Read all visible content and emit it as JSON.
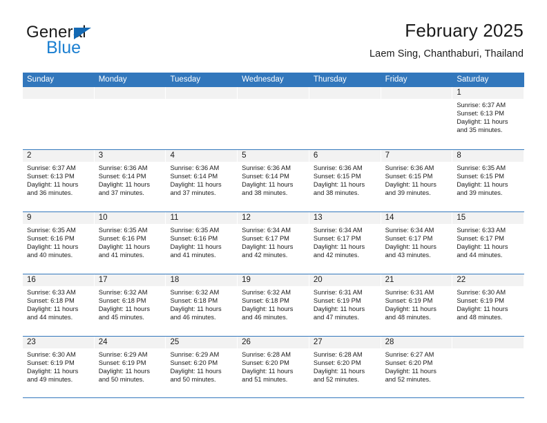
{
  "brand": {
    "name_primary": "General",
    "name_secondary": "Blue",
    "accent_color": "#1268b3",
    "secondary_color": "#1b7fd1"
  },
  "header": {
    "title": "February 2025",
    "subtitle": "Laem Sing, Chanthaburi, Thailand"
  },
  "calendar": {
    "header_bg": "#3277bc",
    "daynum_bg": "#f2f2f2",
    "weekday_headers": [
      "Sunday",
      "Monday",
      "Tuesday",
      "Wednesday",
      "Thursday",
      "Friday",
      "Saturday"
    ],
    "weeks": [
      [
        {
          "day": "",
          "lines": []
        },
        {
          "day": "",
          "lines": []
        },
        {
          "day": "",
          "lines": []
        },
        {
          "day": "",
          "lines": []
        },
        {
          "day": "",
          "lines": []
        },
        {
          "day": "",
          "lines": []
        },
        {
          "day": "1",
          "lines": [
            "Sunrise: 6:37 AM",
            "Sunset: 6:13 PM",
            "Daylight: 11 hours",
            "and 35 minutes."
          ]
        }
      ],
      [
        {
          "day": "2",
          "lines": [
            "Sunrise: 6:37 AM",
            "Sunset: 6:13 PM",
            "Daylight: 11 hours",
            "and 36 minutes."
          ]
        },
        {
          "day": "3",
          "lines": [
            "Sunrise: 6:36 AM",
            "Sunset: 6:14 PM",
            "Daylight: 11 hours",
            "and 37 minutes."
          ]
        },
        {
          "day": "4",
          "lines": [
            "Sunrise: 6:36 AM",
            "Sunset: 6:14 PM",
            "Daylight: 11 hours",
            "and 37 minutes."
          ]
        },
        {
          "day": "5",
          "lines": [
            "Sunrise: 6:36 AM",
            "Sunset: 6:14 PM",
            "Daylight: 11 hours",
            "and 38 minutes."
          ]
        },
        {
          "day": "6",
          "lines": [
            "Sunrise: 6:36 AM",
            "Sunset: 6:15 PM",
            "Daylight: 11 hours",
            "and 38 minutes."
          ]
        },
        {
          "day": "7",
          "lines": [
            "Sunrise: 6:36 AM",
            "Sunset: 6:15 PM",
            "Daylight: 11 hours",
            "and 39 minutes."
          ]
        },
        {
          "day": "8",
          "lines": [
            "Sunrise: 6:35 AM",
            "Sunset: 6:15 PM",
            "Daylight: 11 hours",
            "and 39 minutes."
          ]
        }
      ],
      [
        {
          "day": "9",
          "lines": [
            "Sunrise: 6:35 AM",
            "Sunset: 6:16 PM",
            "Daylight: 11 hours",
            "and 40 minutes."
          ]
        },
        {
          "day": "10",
          "lines": [
            "Sunrise: 6:35 AM",
            "Sunset: 6:16 PM",
            "Daylight: 11 hours",
            "and 41 minutes."
          ]
        },
        {
          "day": "11",
          "lines": [
            "Sunrise: 6:35 AM",
            "Sunset: 6:16 PM",
            "Daylight: 11 hours",
            "and 41 minutes."
          ]
        },
        {
          "day": "12",
          "lines": [
            "Sunrise: 6:34 AM",
            "Sunset: 6:17 PM",
            "Daylight: 11 hours",
            "and 42 minutes."
          ]
        },
        {
          "day": "13",
          "lines": [
            "Sunrise: 6:34 AM",
            "Sunset: 6:17 PM",
            "Daylight: 11 hours",
            "and 42 minutes."
          ]
        },
        {
          "day": "14",
          "lines": [
            "Sunrise: 6:34 AM",
            "Sunset: 6:17 PM",
            "Daylight: 11 hours",
            "and 43 minutes."
          ]
        },
        {
          "day": "15",
          "lines": [
            "Sunrise: 6:33 AM",
            "Sunset: 6:17 PM",
            "Daylight: 11 hours",
            "and 44 minutes."
          ]
        }
      ],
      [
        {
          "day": "16",
          "lines": [
            "Sunrise: 6:33 AM",
            "Sunset: 6:18 PM",
            "Daylight: 11 hours",
            "and 44 minutes."
          ]
        },
        {
          "day": "17",
          "lines": [
            "Sunrise: 6:32 AM",
            "Sunset: 6:18 PM",
            "Daylight: 11 hours",
            "and 45 minutes."
          ]
        },
        {
          "day": "18",
          "lines": [
            "Sunrise: 6:32 AM",
            "Sunset: 6:18 PM",
            "Daylight: 11 hours",
            "and 46 minutes."
          ]
        },
        {
          "day": "19",
          "lines": [
            "Sunrise: 6:32 AM",
            "Sunset: 6:18 PM",
            "Daylight: 11 hours",
            "and 46 minutes."
          ]
        },
        {
          "day": "20",
          "lines": [
            "Sunrise: 6:31 AM",
            "Sunset: 6:19 PM",
            "Daylight: 11 hours",
            "and 47 minutes."
          ]
        },
        {
          "day": "21",
          "lines": [
            "Sunrise: 6:31 AM",
            "Sunset: 6:19 PM",
            "Daylight: 11 hours",
            "and 48 minutes."
          ]
        },
        {
          "day": "22",
          "lines": [
            "Sunrise: 6:30 AM",
            "Sunset: 6:19 PM",
            "Daylight: 11 hours",
            "and 48 minutes."
          ]
        }
      ],
      [
        {
          "day": "23",
          "lines": [
            "Sunrise: 6:30 AM",
            "Sunset: 6:19 PM",
            "Daylight: 11 hours",
            "and 49 minutes."
          ]
        },
        {
          "day": "24",
          "lines": [
            "Sunrise: 6:29 AM",
            "Sunset: 6:19 PM",
            "Daylight: 11 hours",
            "and 50 minutes."
          ]
        },
        {
          "day": "25",
          "lines": [
            "Sunrise: 6:29 AM",
            "Sunset: 6:20 PM",
            "Daylight: 11 hours",
            "and 50 minutes."
          ]
        },
        {
          "day": "26",
          "lines": [
            "Sunrise: 6:28 AM",
            "Sunset: 6:20 PM",
            "Daylight: 11 hours",
            "and 51 minutes."
          ]
        },
        {
          "day": "27",
          "lines": [
            "Sunrise: 6:28 AM",
            "Sunset: 6:20 PM",
            "Daylight: 11 hours",
            "and 52 minutes."
          ]
        },
        {
          "day": "28",
          "lines": [
            "Sunrise: 6:27 AM",
            "Sunset: 6:20 PM",
            "Daylight: 11 hours",
            "and 52 minutes."
          ]
        },
        {
          "day": "",
          "lines": []
        }
      ]
    ]
  }
}
